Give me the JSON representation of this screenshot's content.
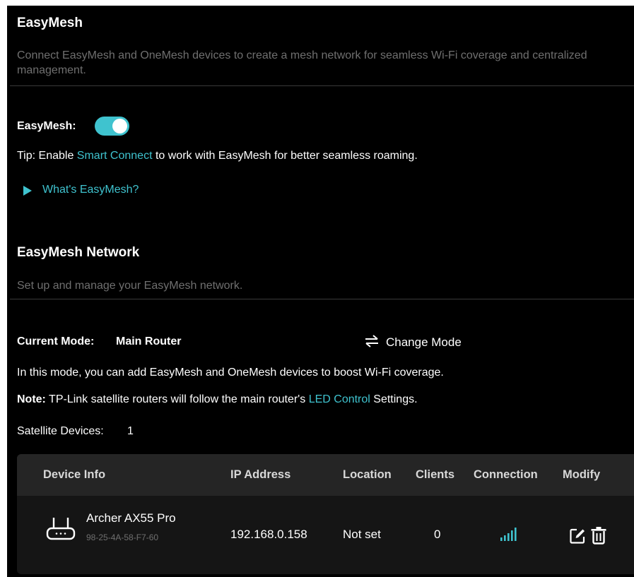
{
  "easymesh": {
    "title": "EasyMesh",
    "description": "Connect EasyMesh and OneMesh devices to create a mesh network for seamless Wi-Fi coverage and centralized management.",
    "toggle_label": "EasyMesh:",
    "toggle_on": true,
    "tip_prefix": "Tip: Enable ",
    "tip_link": "Smart Connect",
    "tip_suffix": " to work with EasyMesh for better seamless roaming.",
    "whats_link": "What's EasyMesh?"
  },
  "network": {
    "title": "EasyMesh Network",
    "description": "Set up and manage your EasyMesh network.",
    "current_mode_label": "Current Mode:",
    "current_mode_value": "Main Router",
    "change_mode_label": "Change Mode",
    "mode_info": "In this mode, you can add EasyMesh and OneMesh devices to boost Wi-Fi coverage.",
    "note_label": "Note:",
    "note_prefix": " TP-Link satellite routers will follow the main router's ",
    "note_link": "LED Control",
    "note_suffix": " Settings.",
    "satellite_label": "Satellite Devices:",
    "satellite_count": "1"
  },
  "table": {
    "headers": {
      "device_info": "Device Info",
      "ip_address": "IP Address",
      "location": "Location",
      "clients": "Clients",
      "connection": "Connection",
      "modify": "Modify"
    },
    "rows": [
      {
        "device_name": "Archer AX55 Pro",
        "mac": "98-25-4A-58-F7-60",
        "ip": "192.168.0.158",
        "location": "Not set",
        "clients": "0",
        "signal_bars": 4,
        "icons": [
          "router-icon",
          "signal-icon",
          "edit-icon",
          "trash-icon"
        ]
      }
    ]
  },
  "colors": {
    "accent": "#3fc3cf",
    "background": "#000000",
    "muted_text": "#6f6f6f",
    "table_header_bg": "#252525",
    "table_body_bg": "#151515"
  }
}
